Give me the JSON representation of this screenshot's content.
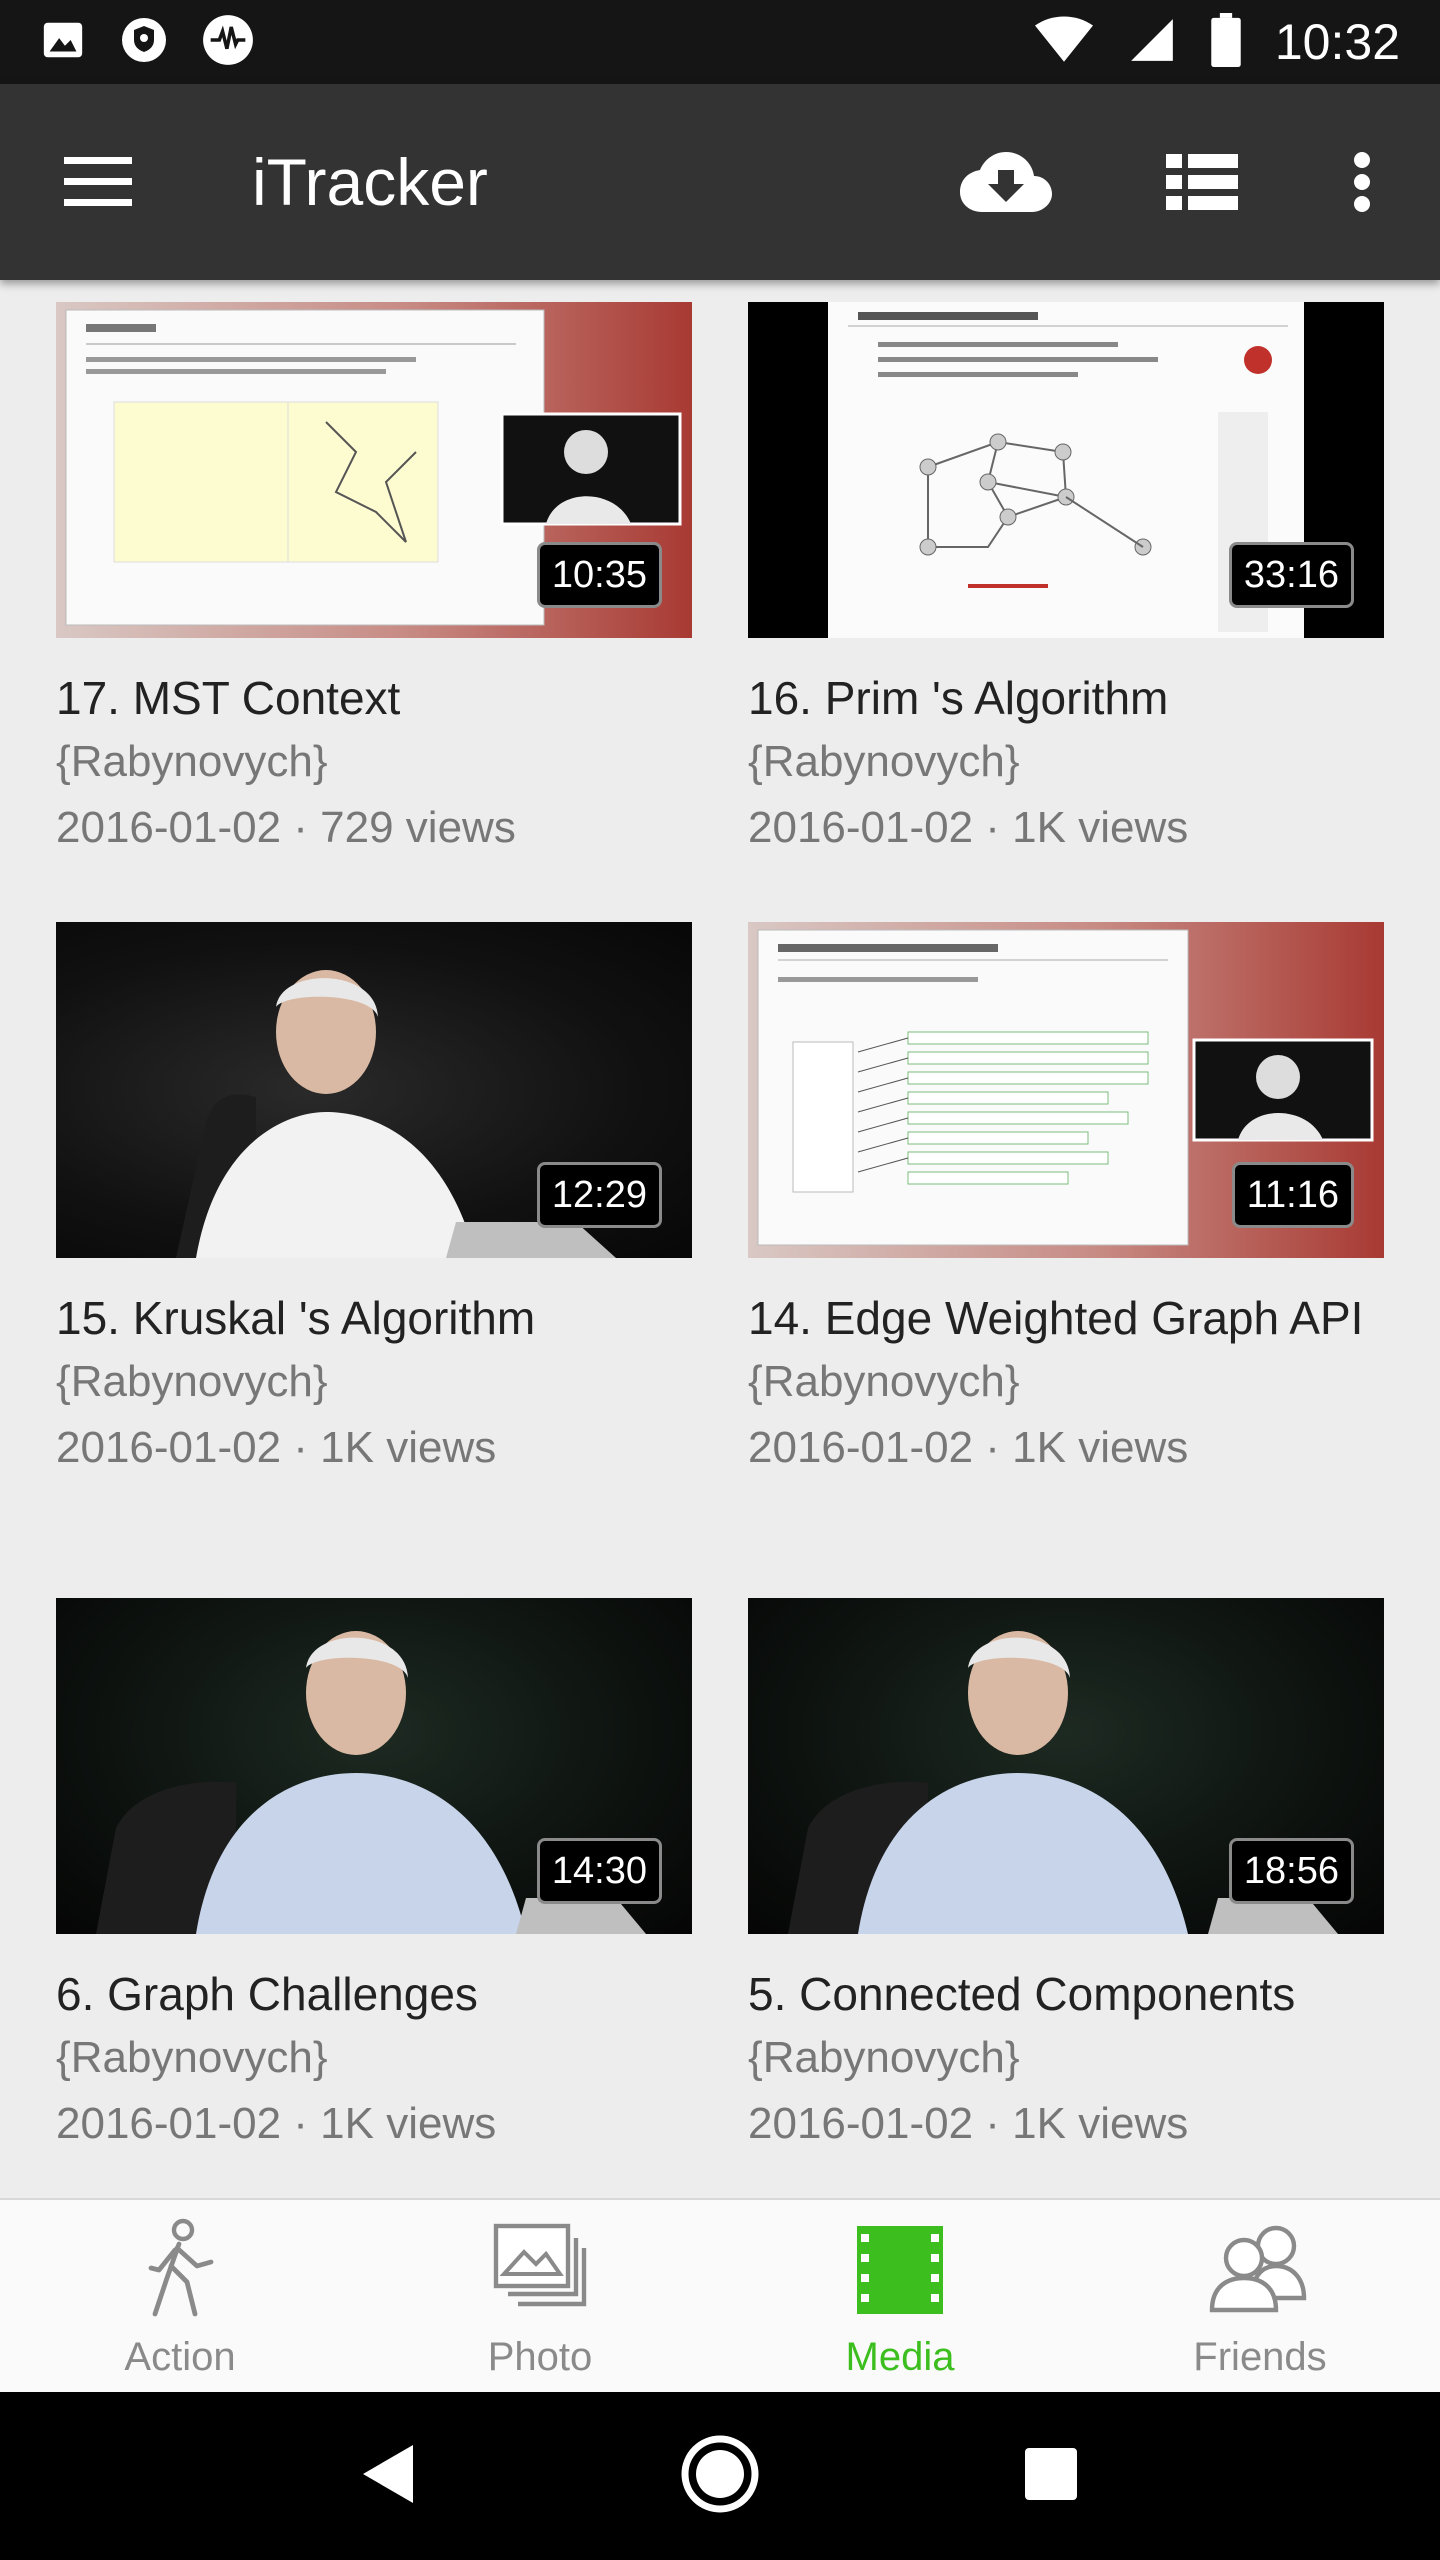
{
  "status_bar": {
    "time": "10:32",
    "icons": [
      "image-icon",
      "vpn-shield-icon",
      "pulse-icon",
      "wifi-icon",
      "signal-icon",
      "battery-icon"
    ]
  },
  "app_bar": {
    "title": "iTracker",
    "icons": [
      "menu-icon",
      "cloud-download-icon",
      "list-view-icon",
      "more-vert-icon"
    ]
  },
  "videos": [
    {
      "title": "17. MST Context",
      "author": "{Rabynovych}",
      "meta": "2016-01-02 · 729 views",
      "duration": "10:35"
    },
    {
      "title": "16. Prim 's Algorithm",
      "author": "{Rabynovych}",
      "meta": "2016-01-02 · 1K views",
      "duration": "33:16"
    },
    {
      "title": "15.  Kruskal 's Algorithm",
      "author": "{Rabynovych}",
      "meta": "2016-01-02 · 1K views",
      "duration": "12:29"
    },
    {
      "title": "14.  Edge Weighted Graph API",
      "author": "{Rabynovych}",
      "meta": "2016-01-02 · 1K views",
      "duration": "11:16"
    },
    {
      "title": "6. Graph Challenges",
      "author": "{Rabynovych}",
      "meta": "2016-01-02 · 1K views",
      "duration": "14:30"
    },
    {
      "title": "5. Connected Components",
      "author": "{Rabynovych}",
      "meta": "2016-01-02 · 1K views",
      "duration": "18:56"
    }
  ],
  "bottom_nav": {
    "items": [
      {
        "label": "Action",
        "icon": "walking-person-icon"
      },
      {
        "label": "Photo",
        "icon": "photo-stack-icon"
      },
      {
        "label": "Media",
        "icon": "film-icon",
        "active": true
      },
      {
        "label": "Friends",
        "icon": "friends-icon"
      }
    ]
  },
  "colors": {
    "accent": "#3cbf1e",
    "app_bar": "#333333",
    "status_bar": "#151515",
    "background": "#ededed"
  }
}
